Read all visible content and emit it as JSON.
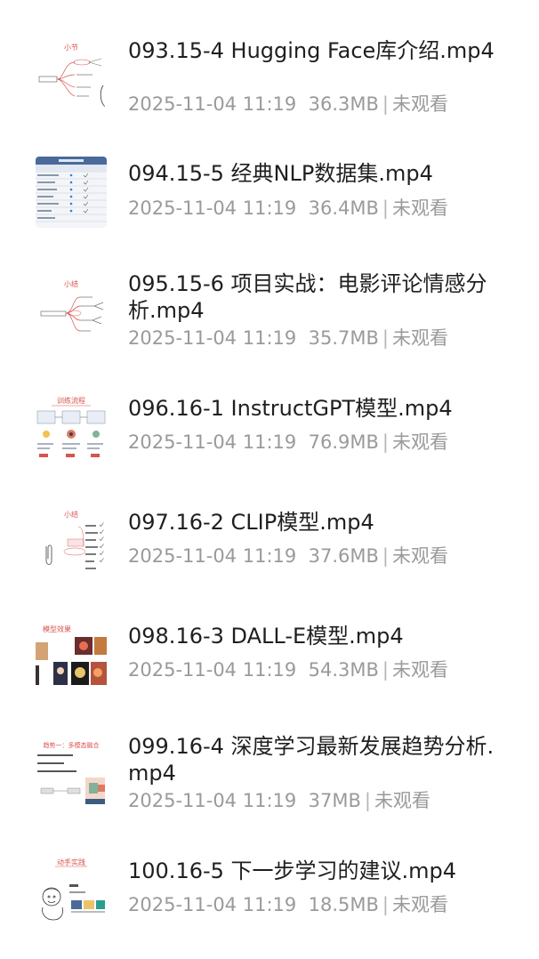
{
  "videos": [
    {
      "title": "093.15-4 Hugging Face库介绍.mp4",
      "date": "2025-11-04 11:19",
      "size": "36.3MB",
      "status": "未观看",
      "thumbnail": "mindmap-thumbnail",
      "thumbnail_caption": "小节"
    },
    {
      "title": "094.15-5 经典NLP数据集.mp4",
      "date": "2025-11-04 11:19",
      "size": "36.4MB",
      "status": "未观看",
      "thumbnail": "table-thumbnail",
      "thumbnail_caption": ""
    },
    {
      "title": "095.15-6 项目实战：电影评论情感分析.mp4",
      "date": "2025-11-04 11:19",
      "size": "35.7MB",
      "status": "未观看",
      "thumbnail": "mindmap-thumbnail",
      "thumbnail_caption": "小结"
    },
    {
      "title": "096.16-1 InstructGPT模型.mp4",
      "date": "2025-11-04 11:19",
      "size": "76.9MB",
      "status": "未观看",
      "thumbnail": "diagram-thumbnail",
      "thumbnail_caption": "训练流程"
    },
    {
      "title": "097.16-2 CLIP模型.mp4",
      "date": "2025-11-04 11:19",
      "size": "37.6MB",
      "status": "未观看",
      "thumbnail": "checklist-thumbnail",
      "thumbnail_caption": "小结"
    },
    {
      "title": "098.16-3 DALL-E模型.mp4",
      "date": "2025-11-04 11:19",
      "size": "54.3MB",
      "status": "未观看",
      "thumbnail": "image-grid-thumbnail",
      "thumbnail_caption": "模型效果"
    },
    {
      "title": "099.16-4 深度学习最新发展趋势分析.mp4",
      "date": "2025-11-04 11:19",
      "size": "37MB",
      "status": "未观看",
      "thumbnail": "slide-thumbnail",
      "thumbnail_caption": "趋势一：多模态融合"
    },
    {
      "title": "100.16-5 下一步学习的建议.mp4",
      "date": "2025-11-04 11:19",
      "size": "18.5MB",
      "status": "未观看",
      "thumbnail": "sketch-thumbnail",
      "thumbnail_caption": "动手实践"
    }
  ],
  "colors": {
    "title": "#1f1f1f",
    "meta": "#9a9a9a",
    "accent": "#d9534f"
  }
}
